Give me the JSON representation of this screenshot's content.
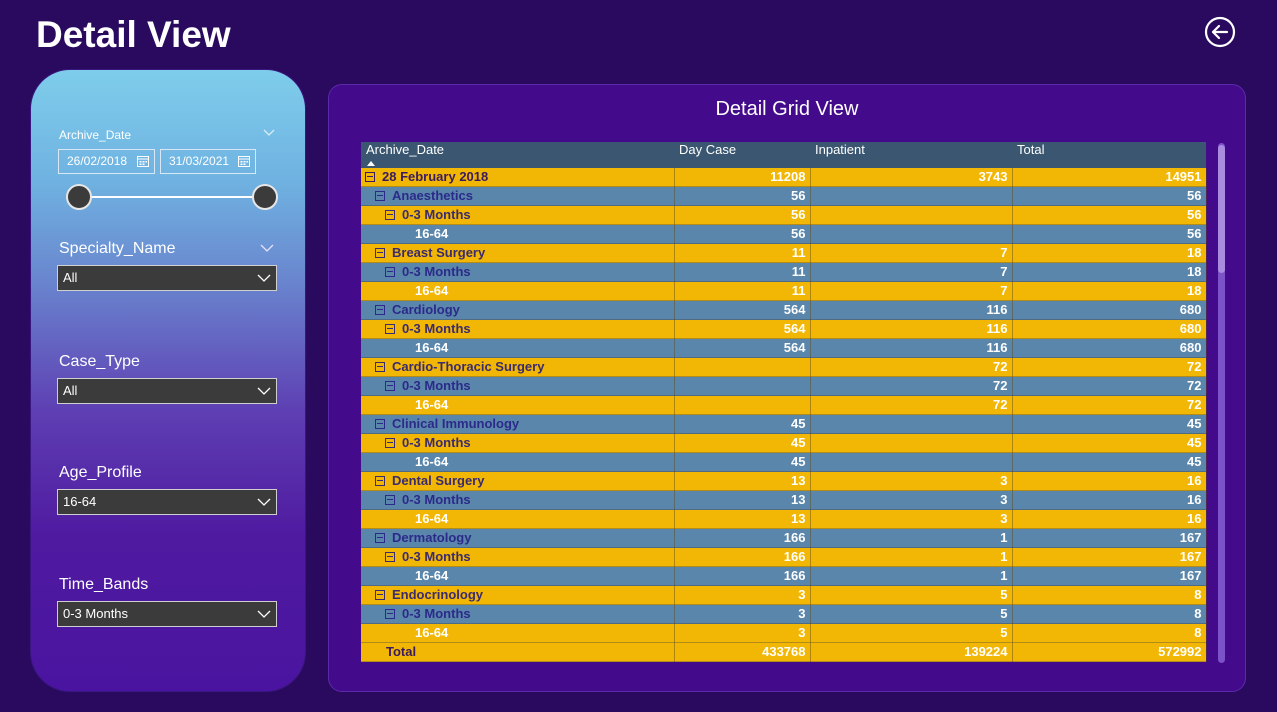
{
  "page": {
    "title": "Detail View"
  },
  "filters": {
    "archive_date": {
      "label": "Archive_Date",
      "start": "26/02/2018",
      "end": "31/03/2021"
    },
    "specialty": {
      "label": "Specialty_Name",
      "value": "All"
    },
    "case_type": {
      "label": "Case_Type",
      "value": "All"
    },
    "age_profile": {
      "label": "Age_Profile",
      "value": "16-64"
    },
    "time_bands": {
      "label": "Time_Bands",
      "value": "0-3 Months"
    }
  },
  "grid": {
    "title": "Detail Grid View",
    "columns": [
      "Archive_Date",
      "Day Case",
      "Inpatient",
      "Total"
    ],
    "rows": [
      {
        "level": 0,
        "color": "yellow",
        "toggle": true,
        "label": "28 February 2018",
        "day": "11208",
        "inp": "3743",
        "tot": "14951"
      },
      {
        "level": 1,
        "color": "blue",
        "toggle": true,
        "label": "Anaesthetics",
        "day": "56",
        "inp": "",
        "tot": "56"
      },
      {
        "level": 2,
        "color": "yellow",
        "toggle": true,
        "label": "0-3 Months",
        "day": "56",
        "inp": "",
        "tot": "56"
      },
      {
        "level": 3,
        "color": "blue",
        "toggle": false,
        "label": "16-64",
        "day": "56",
        "inp": "",
        "tot": "56"
      },
      {
        "level": 1,
        "color": "yellow",
        "toggle": true,
        "label": "Breast Surgery",
        "day": "11",
        "inp": "7",
        "tot": "18"
      },
      {
        "level": 2,
        "color": "blue",
        "toggle": true,
        "label": "0-3 Months",
        "day": "11",
        "inp": "7",
        "tot": "18"
      },
      {
        "level": 3,
        "color": "yellow",
        "toggle": false,
        "label": "16-64",
        "day": "11",
        "inp": "7",
        "tot": "18"
      },
      {
        "level": 1,
        "color": "blue",
        "toggle": true,
        "label": "Cardiology",
        "day": "564",
        "inp": "116",
        "tot": "680"
      },
      {
        "level": 2,
        "color": "yellow",
        "toggle": true,
        "label": "0-3 Months",
        "day": "564",
        "inp": "116",
        "tot": "680"
      },
      {
        "level": 3,
        "color": "blue",
        "toggle": false,
        "label": "16-64",
        "day": "564",
        "inp": "116",
        "tot": "680"
      },
      {
        "level": 1,
        "color": "yellow",
        "toggle": true,
        "label": "Cardio-Thoracic Surgery",
        "day": "",
        "inp": "72",
        "tot": "72"
      },
      {
        "level": 2,
        "color": "blue",
        "toggle": true,
        "label": "0-3 Months",
        "day": "",
        "inp": "72",
        "tot": "72"
      },
      {
        "level": 3,
        "color": "yellow",
        "toggle": false,
        "label": "16-64",
        "day": "",
        "inp": "72",
        "tot": "72"
      },
      {
        "level": 1,
        "color": "blue",
        "toggle": true,
        "label": "Clinical Immunology",
        "day": "45",
        "inp": "",
        "tot": "45"
      },
      {
        "level": 2,
        "color": "yellow",
        "toggle": true,
        "label": "0-3 Months",
        "day": "45",
        "inp": "",
        "tot": "45"
      },
      {
        "level": 3,
        "color": "blue",
        "toggle": false,
        "label": "16-64",
        "day": "45",
        "inp": "",
        "tot": "45"
      },
      {
        "level": 1,
        "color": "yellow",
        "toggle": true,
        "label": "Dental Surgery",
        "day": "13",
        "inp": "3",
        "tot": "16"
      },
      {
        "level": 2,
        "color": "blue",
        "toggle": true,
        "label": "0-3 Months",
        "day": "13",
        "inp": "3",
        "tot": "16"
      },
      {
        "level": 3,
        "color": "yellow",
        "toggle": false,
        "label": "16-64",
        "day": "13",
        "inp": "3",
        "tot": "16"
      },
      {
        "level": 1,
        "color": "blue",
        "toggle": true,
        "label": "Dermatology",
        "day": "166",
        "inp": "1",
        "tot": "167"
      },
      {
        "level": 2,
        "color": "yellow",
        "toggle": true,
        "label": "0-3 Months",
        "day": "166",
        "inp": "1",
        "tot": "167"
      },
      {
        "level": 3,
        "color": "blue",
        "toggle": false,
        "label": "16-64",
        "day": "166",
        "inp": "1",
        "tot": "167"
      },
      {
        "level": 1,
        "color": "yellow",
        "toggle": true,
        "label": "Endocrinology",
        "day": "3",
        "inp": "5",
        "tot": "8"
      },
      {
        "level": 2,
        "color": "blue",
        "toggle": true,
        "label": "0-3 Months",
        "day": "3",
        "inp": "5",
        "tot": "8"
      },
      {
        "level": 3,
        "color": "yellow",
        "toggle": false,
        "label": "16-64",
        "day": "3",
        "inp": "5",
        "tot": "8"
      }
    ],
    "total": {
      "label": "Total",
      "day": "433768",
      "inp": "139224",
      "tot": "572992"
    }
  },
  "colors": {
    "background": "#2a0a5e",
    "grid_panel": "#440a8c",
    "row_yellow": "#f2b705",
    "row_blue": "#5b86ab",
    "header": "#3a5670"
  },
  "icons": {
    "back": "back-arrow-circle-icon",
    "calendar": "calendar-icon",
    "dropdown": "chevron-down-icon"
  }
}
